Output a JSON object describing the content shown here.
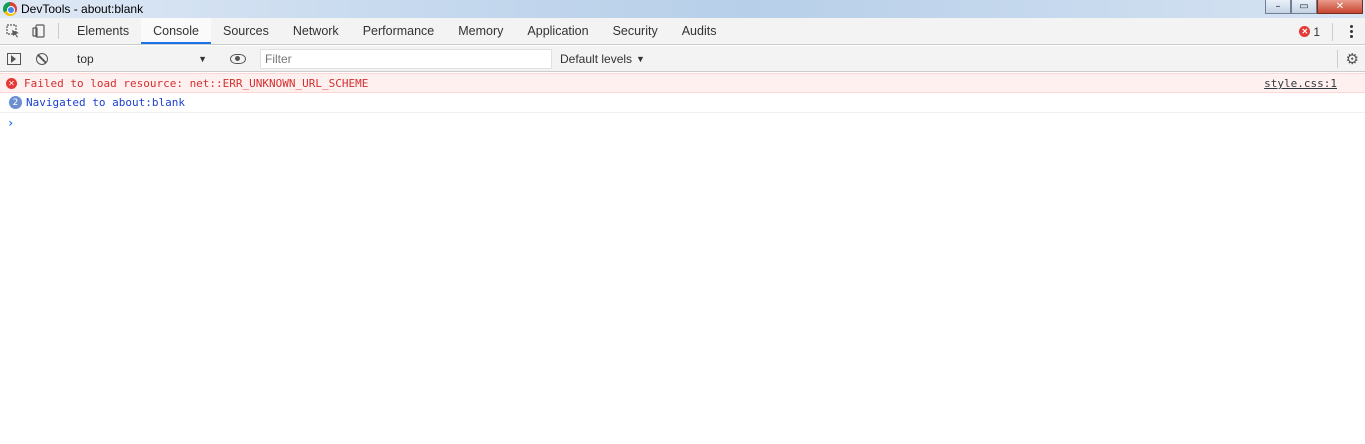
{
  "window": {
    "title": "DevTools - about:blank",
    "controls": {
      "minimize": "–",
      "maximize": "▭",
      "close": "✕"
    }
  },
  "tabs": [
    {
      "label": "Elements",
      "active": false
    },
    {
      "label": "Console",
      "active": true
    },
    {
      "label": "Sources",
      "active": false
    },
    {
      "label": "Network",
      "active": false
    },
    {
      "label": "Performance",
      "active": false
    },
    {
      "label": "Memory",
      "active": false
    },
    {
      "label": "Application",
      "active": false
    },
    {
      "label": "Security",
      "active": false
    },
    {
      "label": "Audits",
      "active": false
    }
  ],
  "error_badge": {
    "count": "1"
  },
  "toolbar": {
    "context": "top",
    "filter_placeholder": "Filter",
    "levels": "Default levels"
  },
  "messages": [
    {
      "type": "error",
      "text": "Failed to load resource: net::ERR_UNKNOWN_URL_SCHEME",
      "source": "style.css:1"
    },
    {
      "type": "info",
      "count": "2",
      "text": "Navigated to about:blank"
    }
  ],
  "colors": {
    "accent": "#1a73e8",
    "error_text": "#d32f2f",
    "error_bg": "#fff0f0",
    "info_text": "#1a3fd1"
  }
}
